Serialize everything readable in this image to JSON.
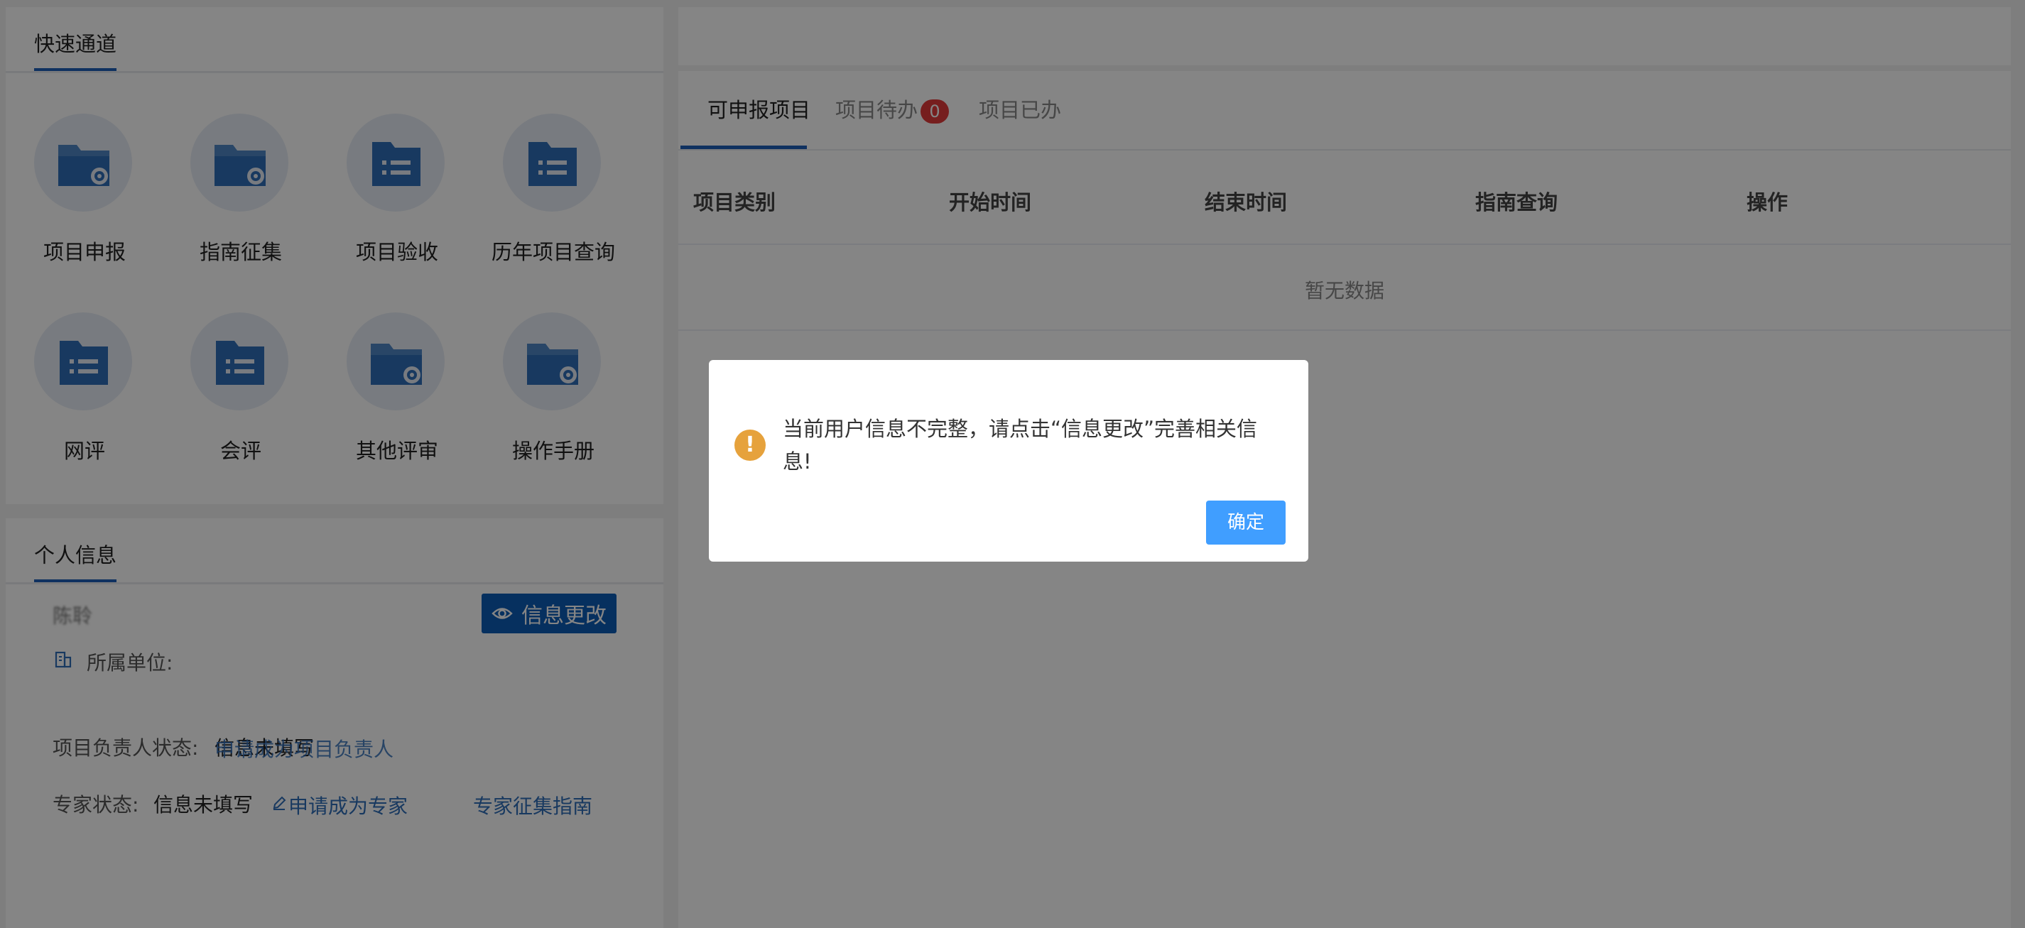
{
  "quick_access": {
    "title": "快速通道",
    "items": [
      {
        "label": "项目申报",
        "icon": "folder-gear-icon"
      },
      {
        "label": "指南征集",
        "icon": "folder-gear-icon"
      },
      {
        "label": "项目验收",
        "icon": "folder-list-icon"
      },
      {
        "label": "历年项目查询",
        "icon": "folder-list-icon"
      },
      {
        "label": "网评",
        "icon": "folder-list-icon"
      },
      {
        "label": "会评",
        "icon": "folder-list-icon"
      },
      {
        "label": "其他评审",
        "icon": "folder-gear-icon"
      },
      {
        "label": "操作手册",
        "icon": "folder-gear-icon"
      }
    ]
  },
  "personal_info": {
    "title": "个人信息",
    "name": "陈聆",
    "edit_button": "信息更改",
    "unit_label": "所属单位:",
    "leader_status_label": "项目负责人状态:",
    "leader_status_value": "信息未填写",
    "apply_leader_link": "申请成为项目负责人",
    "expert_status_label": "专家状态:",
    "expert_status_value": "信息未填写",
    "apply_expert_link": "申请成为专家",
    "expert_guide_link": "专家征集指南"
  },
  "projects": {
    "tabs": [
      {
        "label": "可申报项目",
        "active": true
      },
      {
        "label": "项目待办",
        "badge": "0"
      },
      {
        "label": "项目已办"
      }
    ],
    "columns": [
      "项目类别",
      "开始时间",
      "结束时间",
      "指南查询",
      "操作"
    ],
    "empty_text": "暂无数据"
  },
  "dialog": {
    "message": "当前用户信息不完整，请点击“信息更改”完善相关信息!",
    "confirm": "确定"
  },
  "colors": {
    "accent": "#1e5eb8",
    "icon_blue": "#2f6db8",
    "warn": "#e6a23c",
    "badge": "#e23b3b"
  }
}
